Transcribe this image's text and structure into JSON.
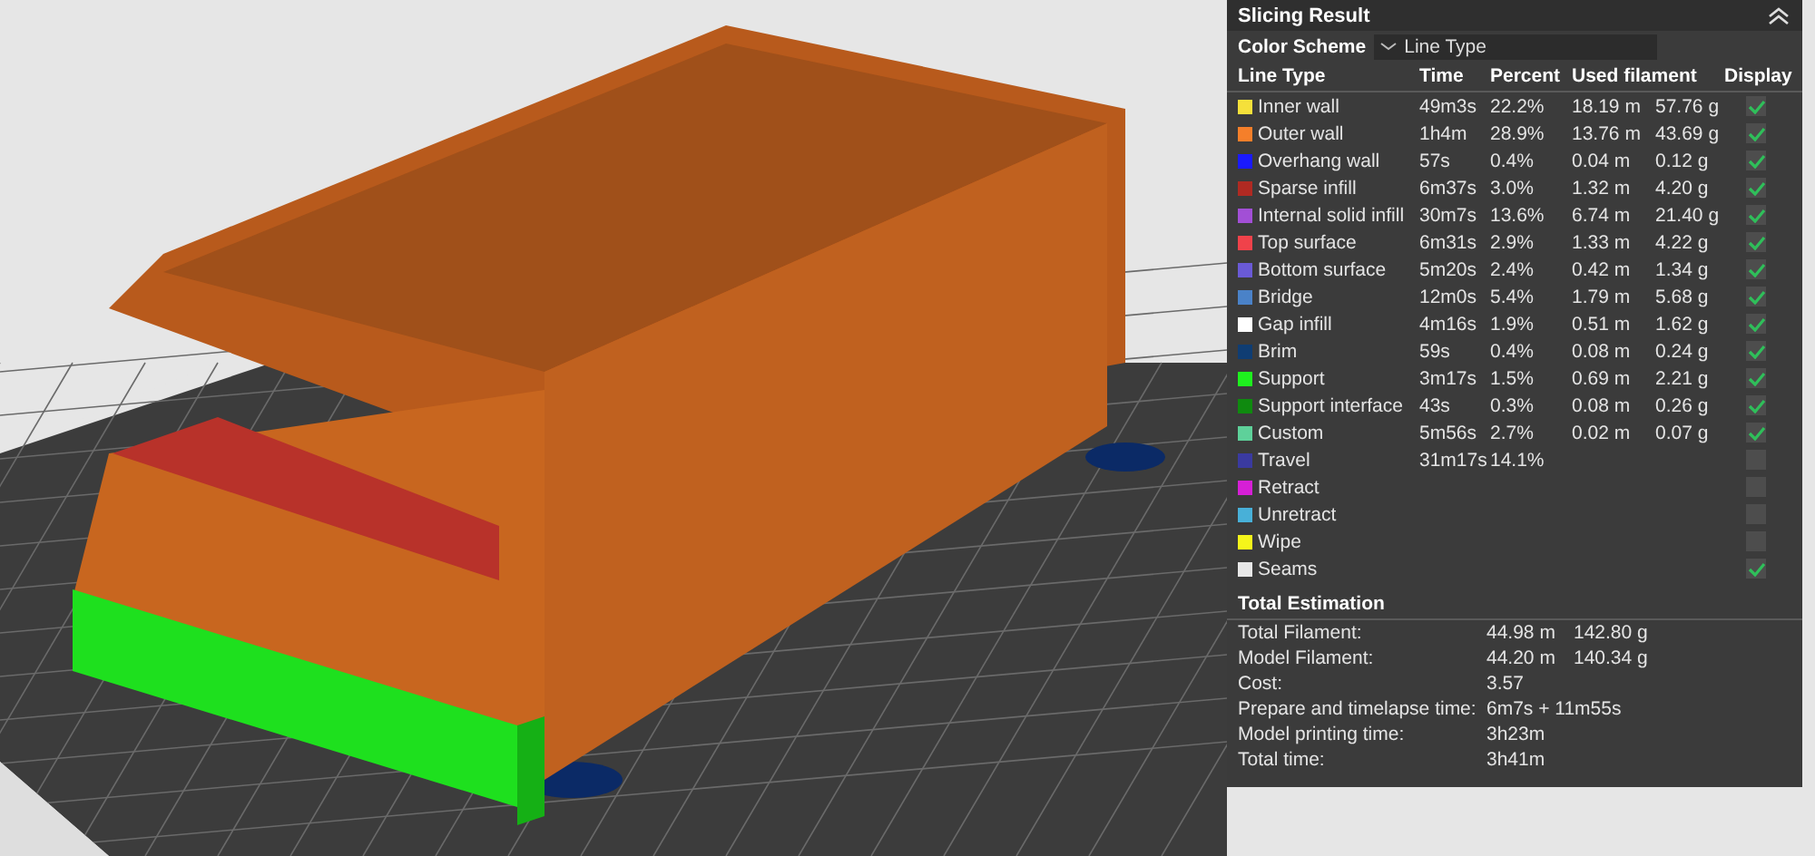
{
  "panel": {
    "title": "Slicing Result",
    "color_scheme": {
      "label": "Color Scheme",
      "value": "Line Type"
    },
    "columns": [
      "Line Type",
      "Time",
      "Percent",
      "Used filament",
      "Display"
    ],
    "rows": [
      {
        "name": "Inner wall",
        "color": "#f5e03a",
        "time": "49m3s",
        "percent": "22.2%",
        "length": "18.19 m",
        "weight": "57.76 g",
        "checked": true
      },
      {
        "name": "Outer wall",
        "color": "#f57f2a",
        "time": "1h4m",
        "percent": "28.9%",
        "length": "13.76 m",
        "weight": "43.69 g",
        "checked": true
      },
      {
        "name": "Overhang wall",
        "color": "#1a1aff",
        "time": "57s",
        "percent": "0.4%",
        "length": "0.04 m",
        "weight": "0.12 g",
        "checked": true
      },
      {
        "name": "Sparse infill",
        "color": "#b02a22",
        "time": "6m37s",
        "percent": "3.0%",
        "length": "1.32 m",
        "weight": "4.20 g",
        "checked": true
      },
      {
        "name": "Internal solid infill",
        "color": "#a24fd6",
        "time": "30m7s",
        "percent": "13.6%",
        "length": "6.74 m",
        "weight": "21.40 g",
        "checked": true
      },
      {
        "name": "Top surface",
        "color": "#f0424a",
        "time": "6m31s",
        "percent": "2.9%",
        "length": "1.33 m",
        "weight": "4.22 g",
        "checked": true
      },
      {
        "name": "Bottom surface",
        "color": "#6a5ad6",
        "time": "5m20s",
        "percent": "2.4%",
        "length": "0.42 m",
        "weight": "1.34 g",
        "checked": true
      },
      {
        "name": "Bridge",
        "color": "#4a82c8",
        "time": "12m0s",
        "percent": "5.4%",
        "length": "1.79 m",
        "weight": "5.68 g",
        "checked": true
      },
      {
        "name": "Gap infill",
        "color": "#ffffff",
        "time": "4m16s",
        "percent": "1.9%",
        "length": "0.51 m",
        "weight": "1.62 g",
        "checked": true
      },
      {
        "name": "Brim",
        "color": "#0f3d73",
        "time": "59s",
        "percent": "0.4%",
        "length": "0.08 m",
        "weight": "0.24 g",
        "checked": true
      },
      {
        "name": "Support",
        "color": "#1ef01e",
        "time": "3m17s",
        "percent": "1.5%",
        "length": "0.69 m",
        "weight": "2.21 g",
        "checked": true
      },
      {
        "name": "Support interface",
        "color": "#0f8a0f",
        "time": "43s",
        "percent": "0.3%",
        "length": "0.08 m",
        "weight": "0.26 g",
        "checked": true
      },
      {
        "name": "Custom",
        "color": "#5ed19a",
        "time": "5m56s",
        "percent": "2.7%",
        "length": "0.02 m",
        "weight": "0.07 g",
        "checked": true
      },
      {
        "name": "Travel",
        "color": "#3a3aa0",
        "time": "31m17s",
        "percent": "14.1%",
        "checked": false
      },
      {
        "name": "Retract",
        "color": "#d61fd6",
        "checked": false
      },
      {
        "name": "Unretract",
        "color": "#48b0d8",
        "checked": false
      },
      {
        "name": "Wipe",
        "color": "#f5f51a",
        "checked": false
      },
      {
        "name": "Seams",
        "color": "#e8e8e8",
        "checked": true
      }
    ],
    "estimation": {
      "title": "Total Estimation",
      "items": [
        {
          "label": "Total Filament:",
          "value": "44.98 m",
          "value_2": "142.80 g"
        },
        {
          "label": "Model Filament:",
          "value": "44.20 m",
          "value_2": "140.34 g"
        },
        {
          "label": "Cost:",
          "value": "3.57"
        },
        {
          "label": "Prepare and timelapse time:",
          "value": "6m7s + 11m55s"
        },
        {
          "label": "Model printing time:",
          "value": "3h23m"
        },
        {
          "label": "Total time:",
          "value": "3h41m"
        }
      ]
    }
  }
}
